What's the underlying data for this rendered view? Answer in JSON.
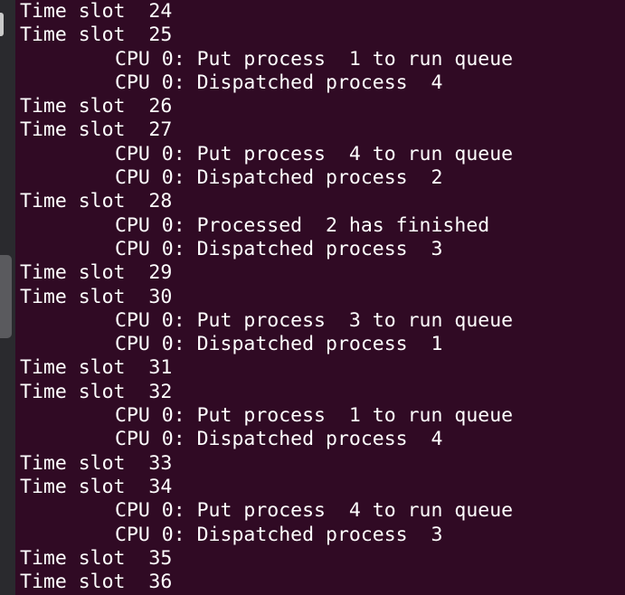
{
  "terminal": {
    "lines": [
      {
        "text": "Time slot  24",
        "indent": false
      },
      {
        "text": "Time slot  25",
        "indent": false
      },
      {
        "text": "CPU 0: Put process  1 to run queue",
        "indent": true
      },
      {
        "text": "CPU 0: Dispatched process  4",
        "indent": true
      },
      {
        "text": "Time slot  26",
        "indent": false
      },
      {
        "text": "Time slot  27",
        "indent": false
      },
      {
        "text": "CPU 0: Put process  4 to run queue",
        "indent": true
      },
      {
        "text": "CPU 0: Dispatched process  2",
        "indent": true
      },
      {
        "text": "Time slot  28",
        "indent": false
      },
      {
        "text": "CPU 0: Processed  2 has finished",
        "indent": true
      },
      {
        "text": "CPU 0: Dispatched process  3",
        "indent": true
      },
      {
        "text": "Time slot  29",
        "indent": false
      },
      {
        "text": "Time slot  30",
        "indent": false
      },
      {
        "text": "CPU 0: Put process  3 to run queue",
        "indent": true
      },
      {
        "text": "CPU 0: Dispatched process  1",
        "indent": true
      },
      {
        "text": "Time slot  31",
        "indent": false
      },
      {
        "text": "Time slot  32",
        "indent": false
      },
      {
        "text": "CPU 0: Put process  1 to run queue",
        "indent": true
      },
      {
        "text": "CPU 0: Dispatched process  4",
        "indent": true
      },
      {
        "text": "Time slot  33",
        "indent": false
      },
      {
        "text": "Time slot  34",
        "indent": false
      },
      {
        "text": "CPU 0: Put process  4 to run queue",
        "indent": true
      },
      {
        "text": "CPU 0: Dispatched process  3",
        "indent": true
      },
      {
        "text": "Time slot  35",
        "indent": false
      },
      {
        "text": "Time slot  36",
        "indent": false
      }
    ]
  },
  "colors": {
    "background": "#300a24",
    "text": "#ffffff",
    "gutter": "#2a2a2e"
  }
}
